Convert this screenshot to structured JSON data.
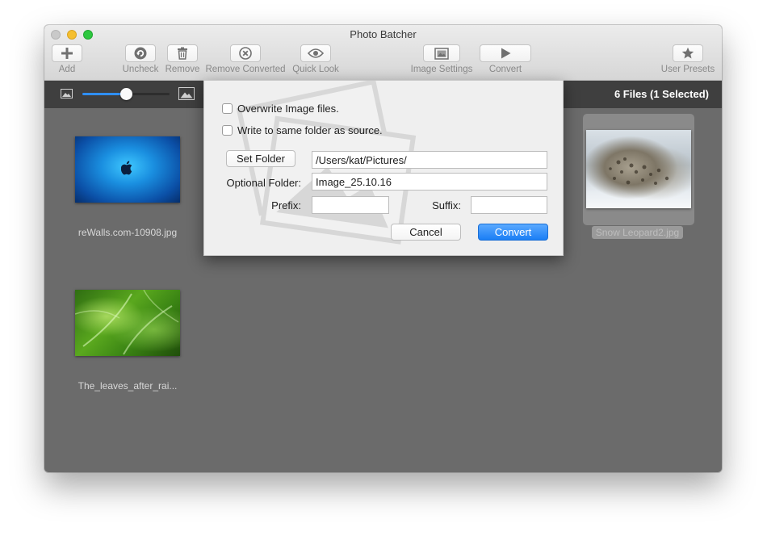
{
  "window": {
    "title": "Photo Batcher"
  },
  "toolbar": {
    "add": "Add",
    "uncheck": "Uncheck",
    "remove": "Remove",
    "remove_converted": "Remove Converted",
    "quick_look": "Quick Look",
    "image_settings": "Image Settings",
    "convert": "Convert",
    "user_presets": "User Presets"
  },
  "subbar": {
    "file_count": "6 Files (1 Selected)",
    "zoom_level": 0.5
  },
  "files": [
    {
      "name": "reWalls.com-10908.jpg",
      "selected": false
    },
    {
      "name": "The_leaves_after_rai...",
      "selected": false
    },
    {
      "name": "Snow Leopard2.jpg",
      "selected": true
    }
  ],
  "dialog": {
    "overwrite_label": "Overwrite Image files.",
    "overwrite_checked": false,
    "same_folder_label": "Write to same folder as source.",
    "same_folder_checked": false,
    "set_folder_button": "Set Folder",
    "folder_path": "/Users/kat/Pictures/",
    "optional_folder_label": "Optional Folder:",
    "optional_folder_value": "Image_25.10.16",
    "prefix_label": "Prefix:",
    "prefix_value": "",
    "suffix_label": "Suffix:",
    "suffix_value": "",
    "cancel_button": "Cancel",
    "convert_button": "Convert"
  },
  "colors": {
    "accent": "#1a7ef5",
    "content_bg": "#6b6b6b",
    "subbar_bg": "#3f3f3f"
  }
}
